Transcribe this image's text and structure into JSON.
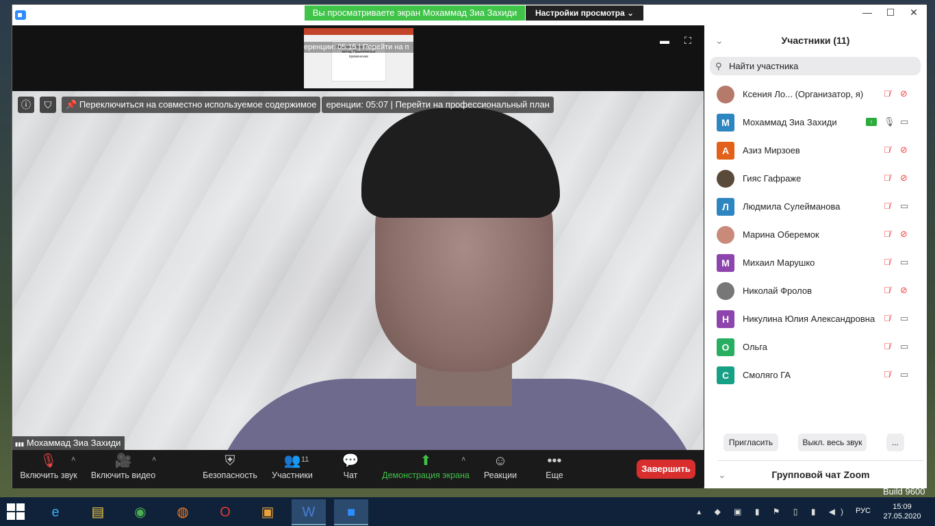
{
  "window": {
    "banner_text": "Вы просматриваете экран Мохаммад Зиа Захиди",
    "view_settings_label": "Настройки просмотра",
    "view_settings_caret": "⌄",
    "minimize": "—",
    "maximize": "☐",
    "close": "✕"
  },
  "stage": {
    "thumbnail_overlay": "еренции: 05:15 | Перейти на п",
    "thumbnail_slide_text": "Введение в тему. Процесс и метод. Практическое применение",
    "switch_text": "Переключиться на совместно используемое содержимое",
    "overlay_text": "еренции: 05:07 | Перейти на профессиональный план",
    "speaker_name": "Мохаммад Зиа Захиди",
    "signal_icon": "▮▮▮",
    "info_icon": "ⓘ",
    "shield_icon": "⛉",
    "pin_icon": "📌"
  },
  "toolbar": {
    "mute_label": "Включить звук",
    "video_label": "Включить видео",
    "security_label": "Безопасность",
    "participants_label": "Участники",
    "participants_count": "11",
    "chat_label": "Чат",
    "share_label": "Демонстрация экрана",
    "reactions_label": "Реакции",
    "more_label": "Еще",
    "end_label": "Завершить",
    "caret": "˄"
  },
  "panel": {
    "title": "Участники (11)",
    "search_placeholder": "Найти участника",
    "participants": [
      {
        "initial": "",
        "name": "Ксения Ло... (Организатор, я)",
        "color": "#b67a6a",
        "mic_muted": true,
        "cam_off": true
      },
      {
        "initial": "М",
        "name": "Мохаммад Зиа Захиди",
        "color": "#2e86c1",
        "mic_muted": false,
        "cam_off": false
      },
      {
        "initial": "А",
        "name": "Азиз Мирзоев",
        "color": "#e2621b",
        "mic_muted": true,
        "cam_off": true
      },
      {
        "initial": "",
        "name": "Гияс Гафраже",
        "color": "#5a4a3a",
        "mic_muted": true,
        "cam_off": true
      },
      {
        "initial": "Л",
        "name": "Людмила Сулейманова",
        "color": "#2e86c1",
        "mic_muted": true,
        "cam_off": false
      },
      {
        "initial": "",
        "name": "Марина Оберемок",
        "color": "#c98a7a",
        "mic_muted": true,
        "cam_off": true
      },
      {
        "initial": "М",
        "name": "Михаил Марушко",
        "color": "#8e44ad",
        "mic_muted": true,
        "cam_off": false
      },
      {
        "initial": "",
        "name": "Николай Фролов",
        "color": "#777777",
        "mic_muted": true,
        "cam_off": true
      },
      {
        "initial": "Н",
        "name": "Никулина Юлия Александровна",
        "color": "#8e44ad",
        "mic_muted": true,
        "cam_off": false
      },
      {
        "initial": "О",
        "name": "Ольга",
        "color": "#27ae60",
        "mic_muted": true,
        "cam_off": false
      },
      {
        "initial": "С",
        "name": "Смоляго ГА",
        "color": "#16a085",
        "mic_muted": true,
        "cam_off": false
      }
    ],
    "invite_label": "Пригласить",
    "mute_all_label": "Выкл. весь звук",
    "more_label": "...",
    "chat_title": "Групповой чат Zoom",
    "chevron": "⌄"
  },
  "taskbar": {
    "language": "РУС",
    "time": "15:09",
    "date": "27.05.2020",
    "build": "Build 9600"
  }
}
